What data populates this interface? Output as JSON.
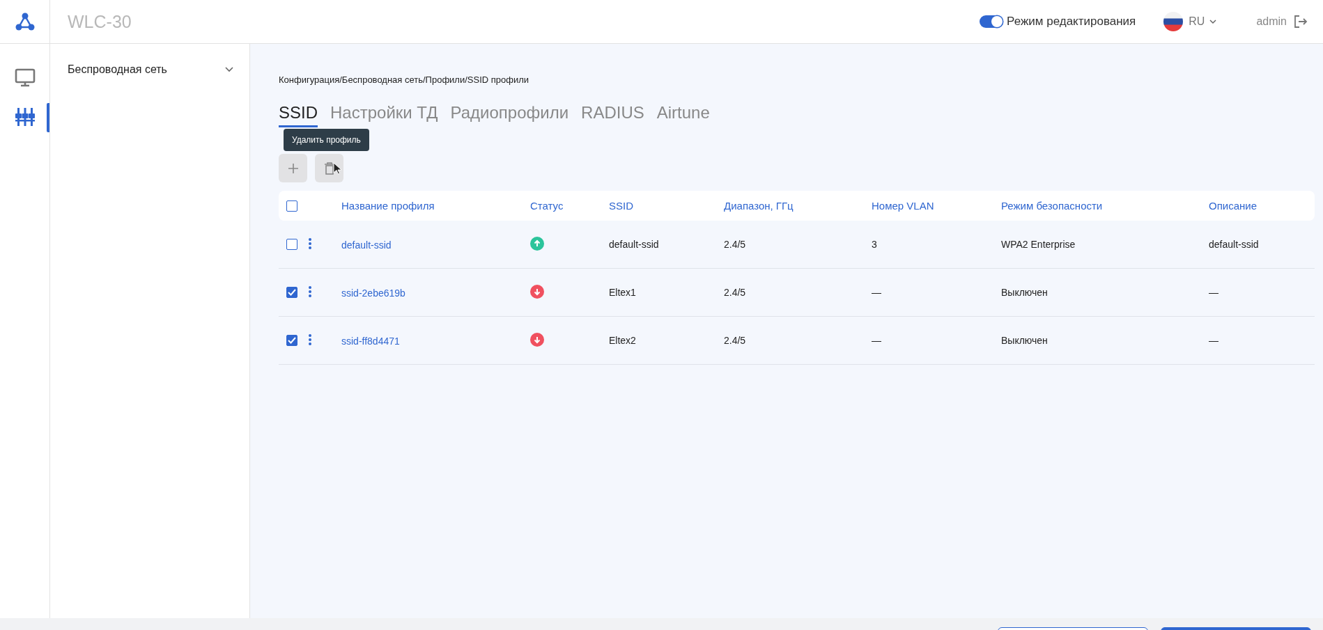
{
  "header": {
    "title": "WLC-30",
    "edit_mode": {
      "label": "Режим редактирования",
      "on": true
    },
    "language": {
      "code": "RU"
    },
    "user": {
      "name": "admin"
    }
  },
  "nav_rail": [
    {
      "kind": "monitor",
      "selected": false
    },
    {
      "kind": "settings",
      "selected": true
    }
  ],
  "sidebar": {
    "items": [
      {
        "label": "Беспроводная сеть",
        "expanded": false
      }
    ]
  },
  "breadcrumb": "Конфигурация/Беспроводная сеть/Профили/SSID профили",
  "tabs": [
    {
      "label": "SSID",
      "selected": true
    },
    {
      "label": "Настройки ТД",
      "selected": false
    },
    {
      "label": "Радиопрофили",
      "selected": false
    },
    {
      "label": "RADIUS",
      "selected": false
    },
    {
      "label": "Airtune",
      "selected": false
    }
  ],
  "toolbar": [
    {
      "kind": "add"
    },
    {
      "kind": "delete",
      "tooltip": "Удалить профиль"
    }
  ],
  "table": {
    "columns": [
      "Название профиля",
      "Статус",
      "SSID",
      "Диапазон, ГГц",
      "Номер VLAN",
      "Режим безопасности",
      "Описание"
    ],
    "all_checked": false,
    "rows": [
      {
        "checked": false,
        "name": "default-ssid",
        "active": true,
        "ssid": "default-ssid",
        "band": "2.4/5",
        "vlan": "3",
        "security": "WPA2 Enterprise",
        "description": "default-ssid"
      },
      {
        "checked": true,
        "name": "ssid-2ebe619b",
        "active": false,
        "ssid": "Eltex1",
        "band": "2.4/5",
        "vlan": "—",
        "security": "Выключен",
        "description": "—"
      },
      {
        "checked": true,
        "name": "ssid-ff8d4471",
        "active": false,
        "ssid": "Eltex2",
        "band": "2.4/5",
        "vlan": "—",
        "security": "Выключен",
        "description": "—"
      }
    ]
  },
  "footer_buttons": [
    {
      "kind": "secondary"
    },
    {
      "kind": "primary"
    }
  ]
}
